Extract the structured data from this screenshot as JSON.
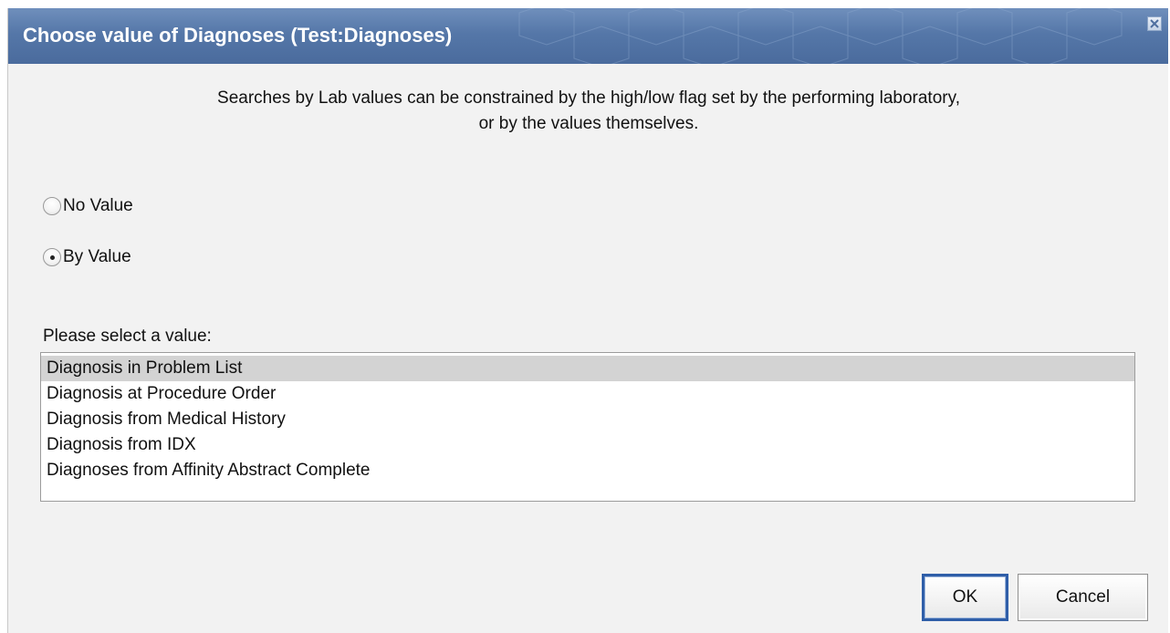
{
  "dialog": {
    "title": "Choose value of Diagnoses (Test:Diagnoses)",
    "close_icon": "close-icon",
    "description_line1": "Searches by Lab values can be constrained by the high/low flag set by the performing laboratory,",
    "description_line2": "or by the values themselves."
  },
  "options": {
    "no_value_label": "No Value",
    "by_value_label": "By Value",
    "selected": "By Value"
  },
  "value_list": {
    "label": "Please select a value:",
    "items": [
      "Diagnosis in Problem List",
      "Diagnosis at Procedure Order",
      "Diagnosis from Medical History",
      "Diagnosis from IDX",
      "Diagnoses from Affinity Abstract Complete"
    ],
    "selected_item": "Diagnosis in Problem List"
  },
  "buttons": {
    "ok_label": "OK",
    "cancel_label": "Cancel"
  },
  "colors": {
    "titlebar": "#5577a8",
    "dialog_bg": "#f2f2f2",
    "selected_row": "#d3d3d3",
    "default_button_border": "#2f5ea8"
  }
}
